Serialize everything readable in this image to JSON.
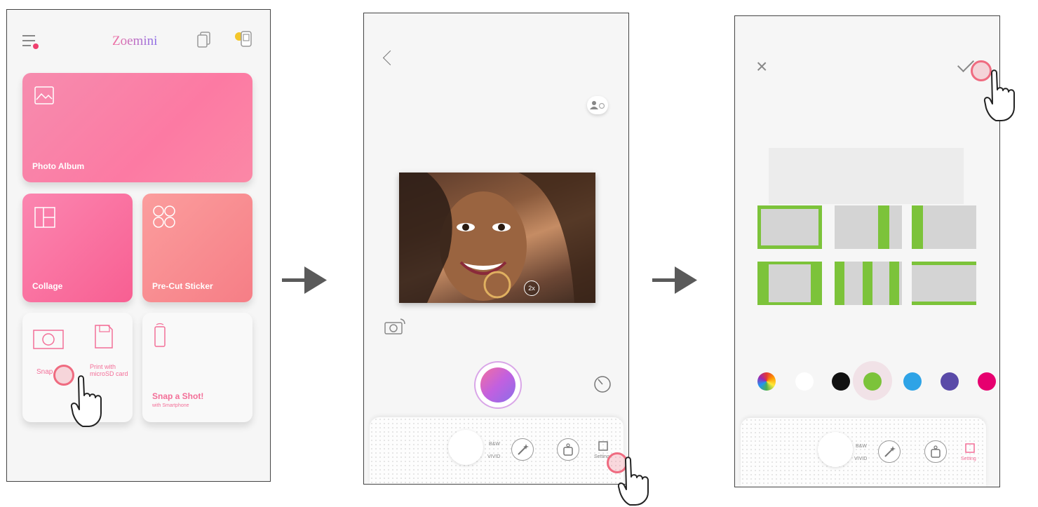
{
  "screen1": {
    "brand": "Zoemini",
    "tiles": {
      "photo_album": "Photo Album",
      "collage": "Collage",
      "pre_cut_sticker": "Pre-Cut Sticker",
      "snap_label": "Snap",
      "print_sd": "Print with microSD card",
      "snap_shot_title": "Snap a Shot!",
      "snap_shot_sub": "with Smartphone"
    }
  },
  "screen2": {
    "zoom_label": "2x",
    "bw_label": "B&W",
    "vivid_label": "VIVID",
    "setting_label": "Setting"
  },
  "screen3": {
    "bw_label": "B&W",
    "vivid_label": "VIVID",
    "setting_label": "Setting",
    "colors": [
      "#f0a020",
      "#ffffff",
      "#111111",
      "#7cc33a",
      "#2ea3e6",
      "#5a4aa8",
      "#e6006f"
    ],
    "accent_frame_color": "#7cc33a"
  },
  "colors": {
    "accent_pink": "#f36f98",
    "tap_ring": "#ef6b80",
    "arrow": "#5a5a5a"
  }
}
